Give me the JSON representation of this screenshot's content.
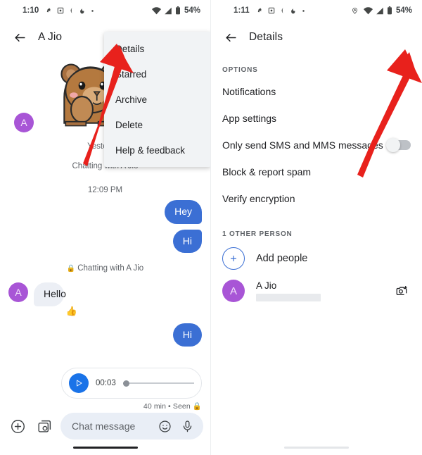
{
  "left_screen": {
    "status_bar": {
      "time": "1:10",
      "left_icons": [
        "dnd-icon",
        "screenshot-icon",
        "crescent-moon-icon",
        "data-saver-icon",
        "dot-icon"
      ],
      "right_icons": [
        "wifi-icon",
        "cellular-signal-icon",
        "battery-icon"
      ],
      "battery_percent": "54%"
    },
    "app_bar": {
      "back_icon": "arrow-left-icon",
      "title": "A Jio"
    },
    "overflow_menu": {
      "items": [
        {
          "label": "Details"
        },
        {
          "label": "Starred"
        },
        {
          "label": "Archive"
        },
        {
          "label": "Delete"
        },
        {
          "label": "Help & feedback"
        }
      ]
    },
    "chat": {
      "sticker": "brown-bear-sticker",
      "avatar_initial": "A",
      "day_label": "Yesterday",
      "system_line_1": "Chatting with A Jio",
      "timestamp": "12:09 PM",
      "messages": [
        {
          "text": "Hey",
          "side": "out"
        },
        {
          "text": "Hi",
          "side": "out"
        }
      ],
      "system_line_2": "Chatting with A Jio",
      "incoming": {
        "text": "Hello",
        "avatar_initial": "A",
        "reaction": "👍"
      },
      "reply": {
        "text": "Hi",
        "side": "out"
      },
      "audio_message": {
        "play_icon": "play-icon",
        "duration": "00:03",
        "meta": "40 min • Seen"
      }
    },
    "composer": {
      "plus_icon": "plus-circle-icon",
      "gallery_icon": "gallery-camera-icon",
      "placeholder": "Chat message",
      "emoji_icon": "emoji-smiley-icon",
      "mic_icon": "microphone-icon"
    }
  },
  "right_screen": {
    "status_bar": {
      "time": "1:11",
      "left_icons": [
        "dnd-icon",
        "screenshot-icon",
        "crescent-moon-icon",
        "data-saver-icon",
        "dot-icon"
      ],
      "right_icons": [
        "location-pin-icon",
        "wifi-icon",
        "cellular-signal-icon",
        "battery-icon"
      ],
      "battery_percent": "54%"
    },
    "app_bar": {
      "back_icon": "arrow-left-icon",
      "title": "Details"
    },
    "options_header": "OPTIONS",
    "options": [
      {
        "label": "Notifications",
        "has_switch": false
      },
      {
        "label": "App settings",
        "has_switch": false
      },
      {
        "label": "Only send SMS and MMS messages",
        "has_switch": true,
        "switch_on": false
      },
      {
        "label": "Block & report spam",
        "has_switch": false
      },
      {
        "label": "Verify encryption",
        "has_switch": false
      }
    ],
    "people_header": "1 OTHER PERSON",
    "add_people_label": "Add people",
    "person": {
      "avatar_initial": "A",
      "name": "A Jio",
      "number": "",
      "camera_icon": "add-photo-camera-icon"
    }
  },
  "annotations": {
    "arrow_color": "#e8211c",
    "arrow_left_target": "Details menu item",
    "arrow_right_target": "Only send SMS and MMS messages toggle"
  },
  "colors": {
    "outgoing_bubble": "#3b6fd4",
    "incoming_bubble": "#eceff5",
    "avatar_purple": "#a855d6",
    "accent_blue": "#1a73e8",
    "menu_bg": "#f1f3f5",
    "composer_bg": "#e9eef6"
  }
}
